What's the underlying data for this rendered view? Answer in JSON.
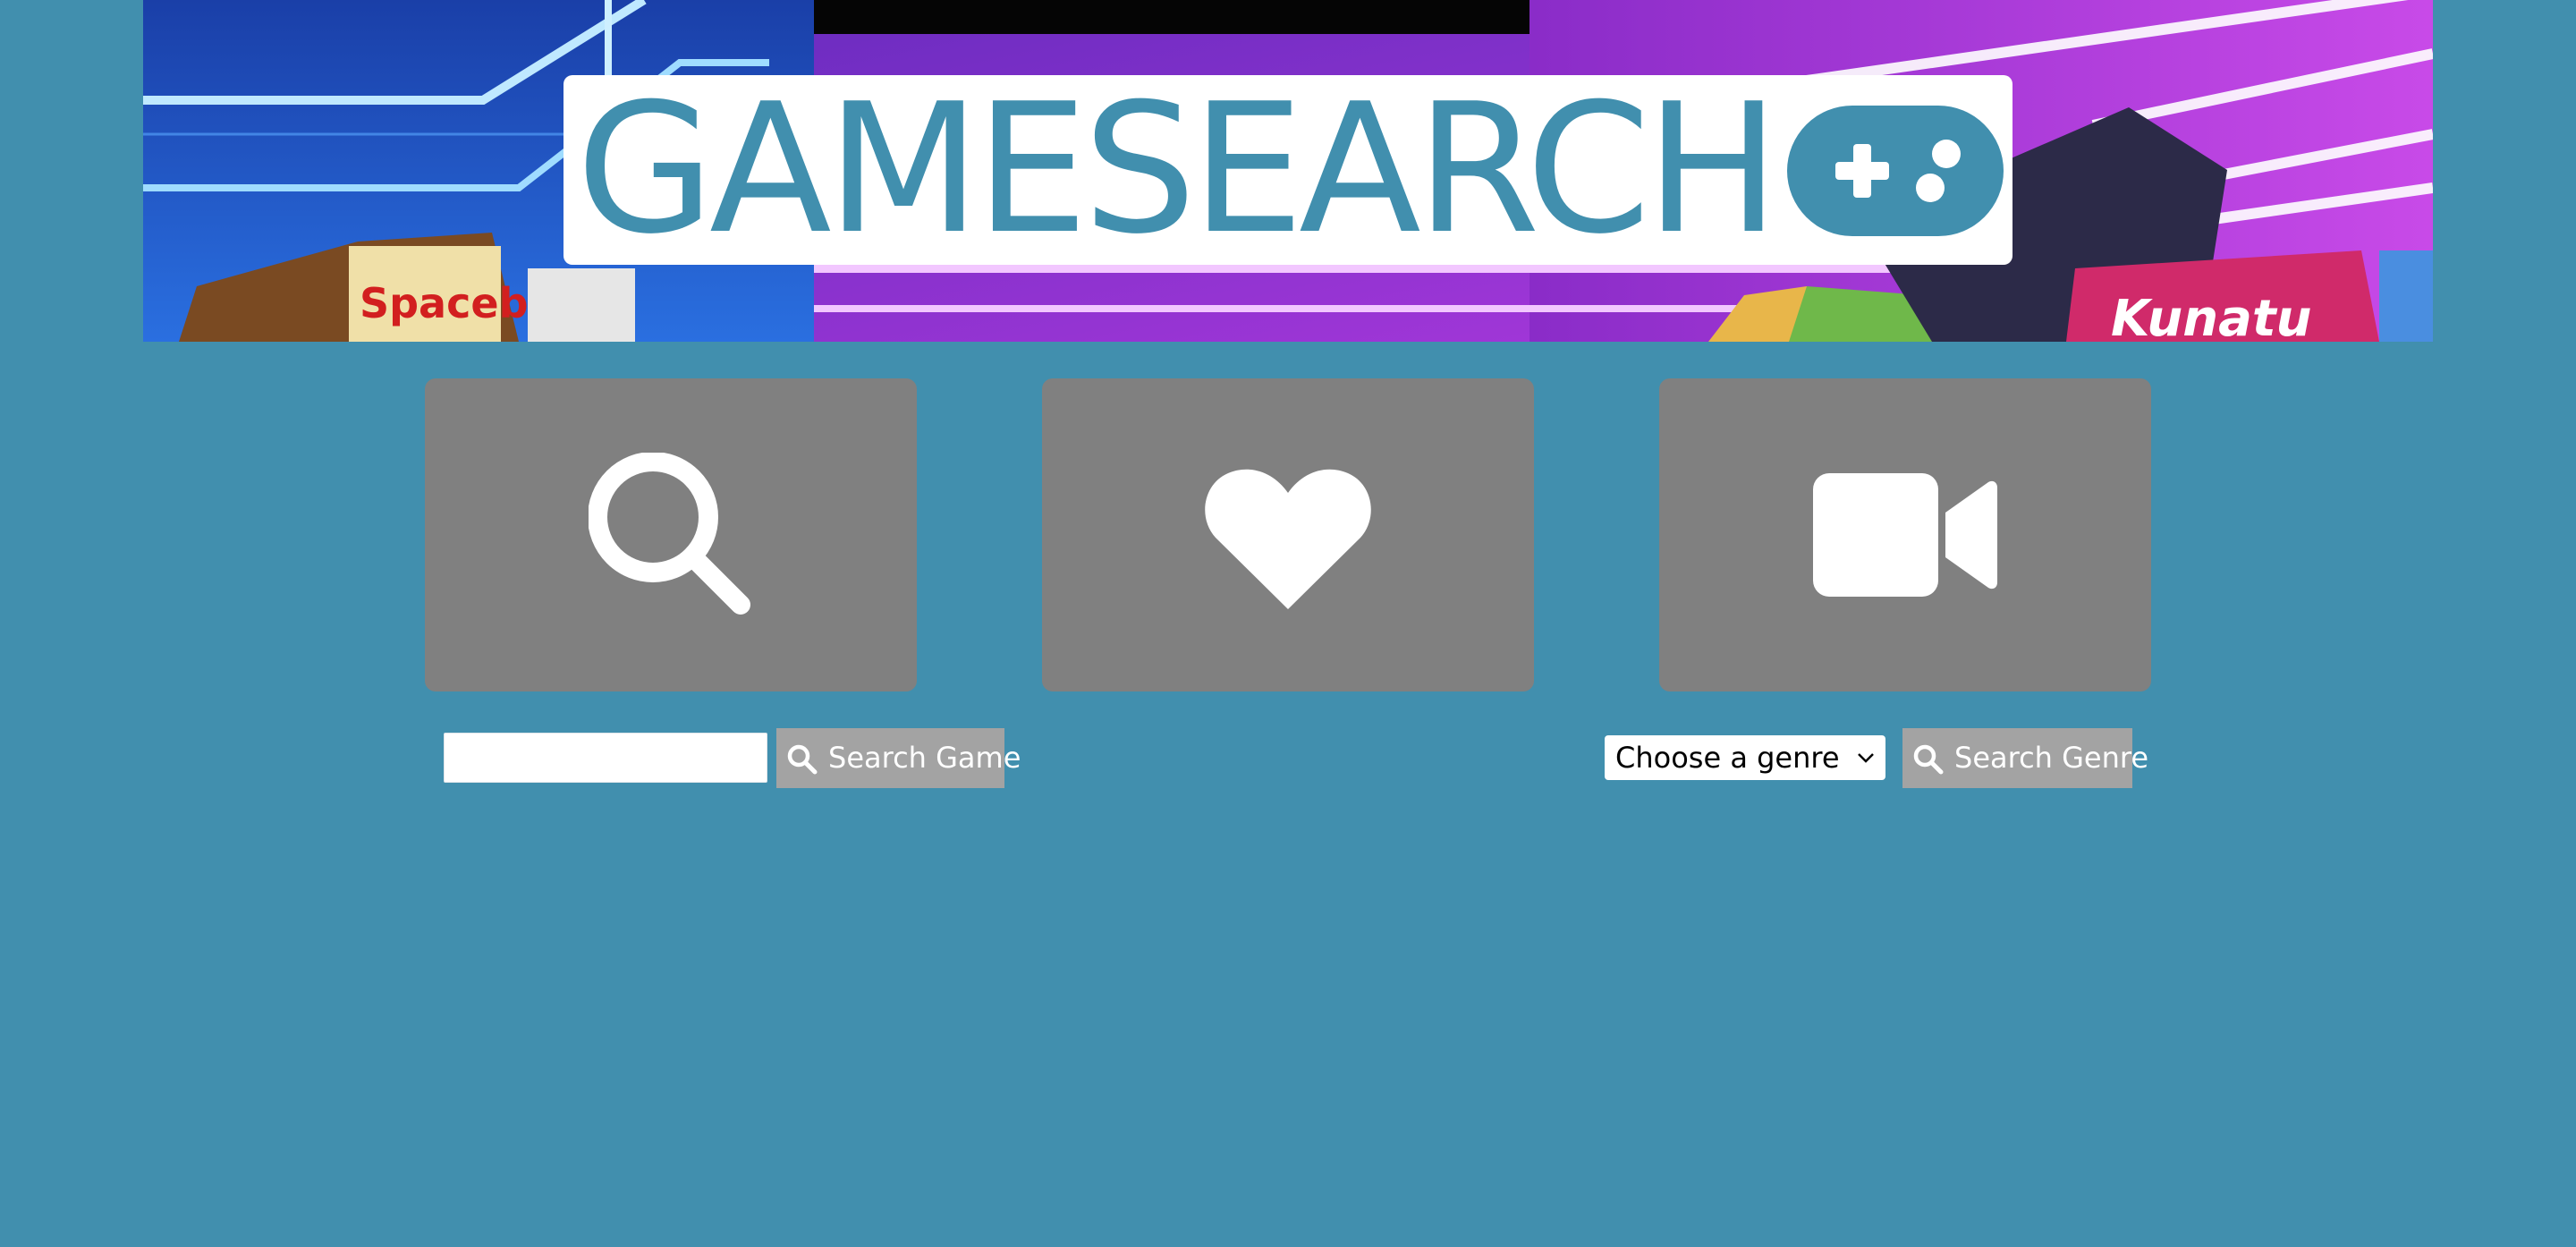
{
  "header": {
    "logo_text": "GAMESEARCH",
    "logo_icon": "gamepad-icon",
    "background": "neon arcade illustration"
  },
  "tiles": [
    {
      "icon": "search-icon"
    },
    {
      "icon": "heart-icon"
    },
    {
      "icon": "video-camera-icon"
    }
  ],
  "search": {
    "input_value": "",
    "placeholder": "",
    "button_label": "Search Game"
  },
  "genre": {
    "selected": "Choose a genre",
    "button_label": "Search Genre"
  },
  "colors": {
    "background": "#418fae",
    "tile": "#808080",
    "button": "#a3a3a3",
    "logo": "#418fae"
  }
}
